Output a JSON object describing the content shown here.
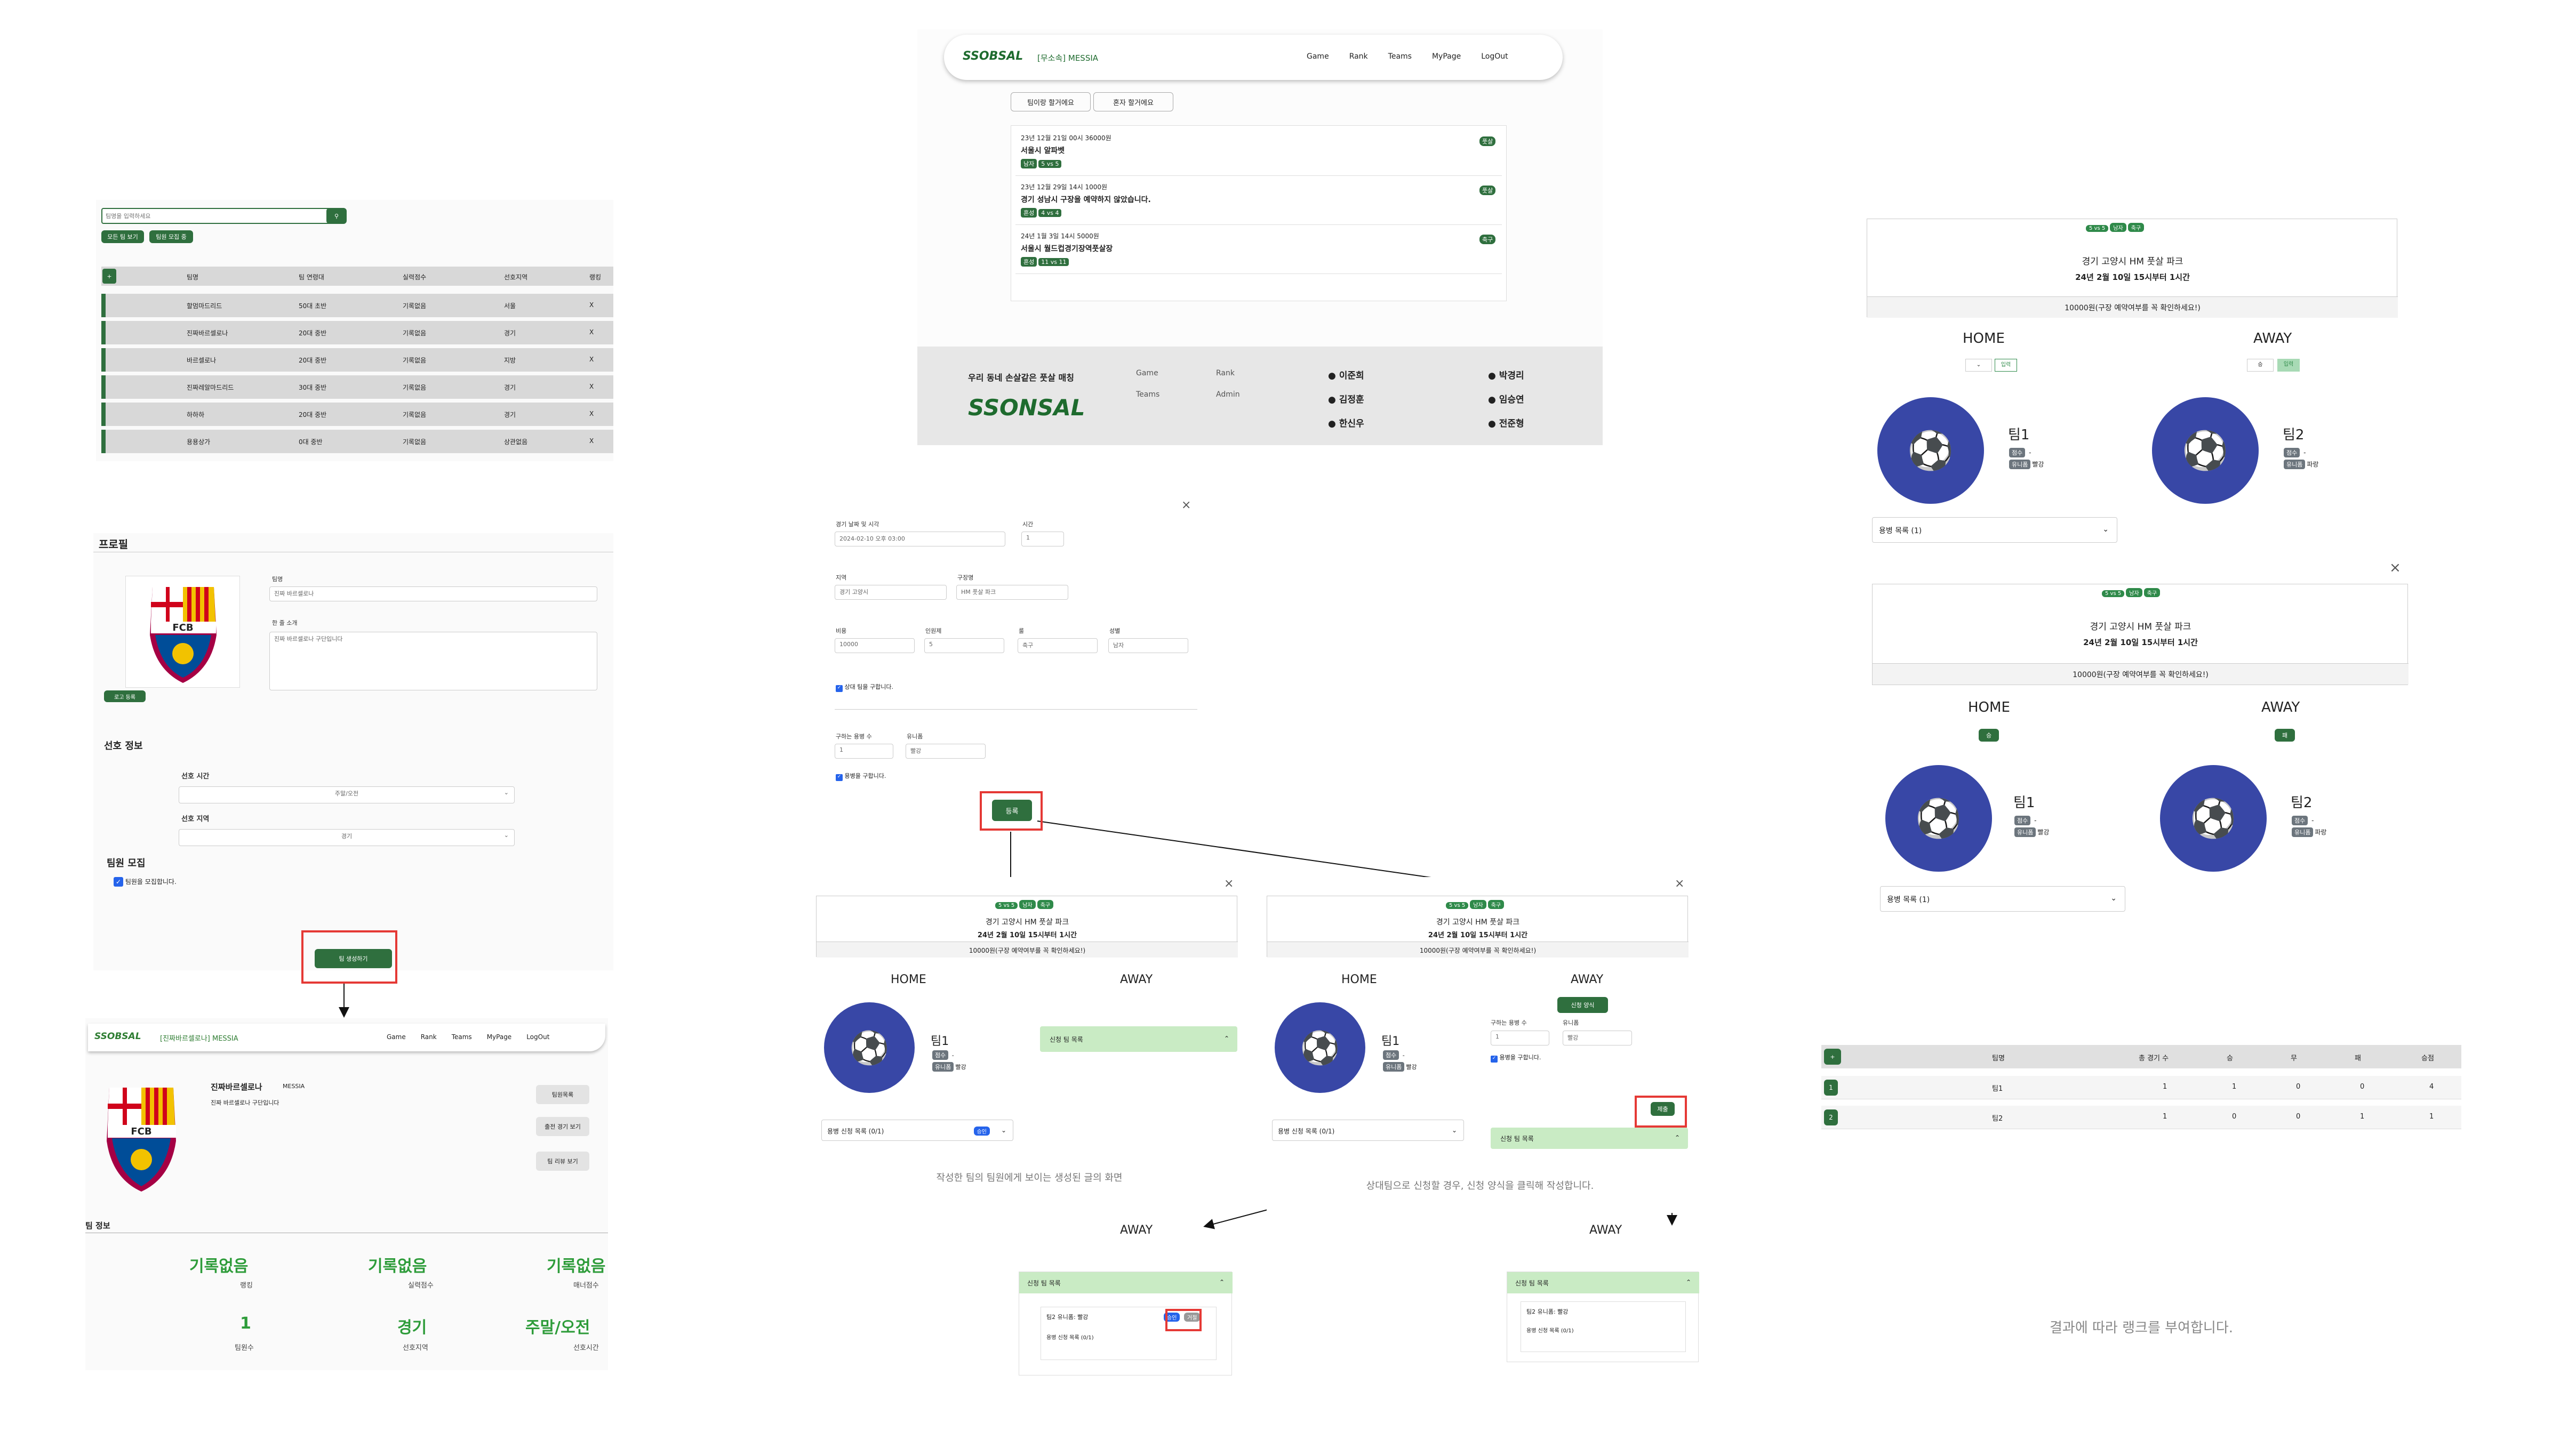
{
  "team_list": {
    "search_placeholder": "팀명을 입력하세요",
    "btn_all": "모든 팀 보기",
    "btn_recruit": "팀원 모집 중",
    "headers": [
      "팀명",
      "팀 연령대",
      "실력점수",
      "선호지역",
      "랭킹"
    ],
    "rows": [
      [
        "할멈마드리드",
        "50대 초반",
        "기록없음",
        "서울",
        "X"
      ],
      [
        "진짜바르셀로나",
        "20대 중반",
        "기록없음",
        "경기",
        "X"
      ],
      [
        "바르셀로나",
        "20대 중반",
        "기록없음",
        "지방",
        "X"
      ],
      [
        "진짜레알마드리드",
        "30대 중반",
        "기록없음",
        "경기",
        "X"
      ],
      [
        "하하하",
        "20대 중반",
        "기록없음",
        "경기",
        "X"
      ],
      [
        "용용상가",
        "0대 중반",
        "기록없음",
        "상관없음",
        "X"
      ]
    ]
  },
  "profile_form": {
    "title": "프로필",
    "logo_btn": "로고 등록",
    "team_name_label": "팀명",
    "team_name_value": "진짜 바르셀로나",
    "intro_label": "한 줄 소개",
    "intro_value": "진짜 바르셀로나 구단입니다",
    "pref_title": "선호 정보",
    "pref_time_label": "선호 시간",
    "pref_time_value": "주말/오전",
    "pref_area_label": "선호 지역",
    "pref_area_value": "경기",
    "recruit_title": "팀원 모집",
    "recruit_check": "팀원을 모집합니다.",
    "create_btn": "팀 생성하기"
  },
  "team_page": {
    "logo": "SSOBSAL",
    "user": "[진짜바르셀로나] MESSIA",
    "nav": [
      "Game",
      "Rank",
      "Teams",
      "MyPage",
      "LogOut"
    ],
    "team_name": "진짜바르셀로나",
    "leader": "MESSIA",
    "intro": "진짜 바르셀로나 구단입니다",
    "btn_members": "팀원목록",
    "btn_games": "출전 경기 보기",
    "btn_reviews": "팀 리뷰 보기",
    "section": "팀 정보",
    "stats": [
      {
        "value": "기록없음",
        "label": "랭킹"
      },
      {
        "value": "기록없음",
        "label": "실력점수"
      },
      {
        "value": "기록없음",
        "label": "매너점수"
      },
      {
        "value": "1",
        "label": "팀원수"
      },
      {
        "value": "경기",
        "label": "선호지역"
      },
      {
        "value": "주말/오전",
        "label": "선호시간"
      }
    ]
  },
  "home": {
    "logo": "SSOBSAL",
    "user": "[무소속] MESSIA",
    "nav": [
      "Game",
      "Rank",
      "Teams",
      "MyPage",
      "LogOut"
    ],
    "tab_team": "팀이랑 할거에요",
    "tab_solo": "혼자 할거에요",
    "games": [
      {
        "meta": "23년 12월 21일 00시 36000원",
        "title": "서울시 알파벳",
        "tags": [
          "남자",
          "5 vs 5"
        ],
        "kind": "풋살"
      },
      {
        "meta": "23년 12월 29일 14시 1000원",
        "title": "경기 성남시 구장을 예약하지 않았습니다.",
        "tags": [
          "혼성",
          "4 vs 4"
        ],
        "kind": "풋살"
      },
      {
        "meta": "24년 1월 3일 14시 5000원",
        "title": "서울시 월드컵경기장역풋살장",
        "tags": [
          "혼성",
          "11 vs 11"
        ],
        "kind": "축구"
      }
    ],
    "footer_slogan": "우리 동네 손살같은 풋살 매칭",
    "footer_logo": "SSONSAL",
    "footer_links": [
      "Game",
      "Rank",
      "Teams",
      "Admin"
    ],
    "members": [
      "이준희",
      "박경리",
      "김정훈",
      "임승연",
      "한신우",
      "전준형"
    ]
  },
  "game_form": {
    "date_label": "경기 날짜 및 시각",
    "date_value": "2024-02-10 오후 03:00",
    "time_label": "시간",
    "time_value": "1",
    "region_label": "지역",
    "region_value": "경기 고양시",
    "stadium_label": "구장명",
    "stadium_value": "HM 풋살 파크",
    "cost_label": "비용",
    "cost_value": "10000",
    "people_label": "인원제",
    "people_value": "5",
    "type_label": "룰",
    "type_value": "축구",
    "gender_label": "성별",
    "gender_value": "남자",
    "opp_check": "상대 팀을 구합니다.",
    "merc_label": "구하는 용병 수",
    "merc_value": "1",
    "uniform_label": "유니폼",
    "uniform_value": "빨강",
    "merc_check": "용병을 구합니다.",
    "submit": "등록"
  },
  "game_card": {
    "tags": [
      "5 vs 5",
      "남자",
      "축구"
    ],
    "place": "경기 고양시 HM 풋살 파크",
    "when": "24년 2월 10일 15시부터 1시간",
    "cost": "10000원(구장 예약여부를 꼭 확인하세요!)",
    "home": "HOME",
    "away": "AWAY",
    "team1": "팀1",
    "team2": "팀2",
    "tag_score": "점수",
    "tag_uniform": "유니폼",
    "uniform1": "빨강",
    "uniform2": "파랑",
    "merc_list": "용병 신청 목록 (0/1)",
    "apply_list": "신청 팀 목록",
    "apply_form": "신청 양식",
    "apply_btn": "제출",
    "caption_member": "작성한 팀의 팀원에게 보이는 생성된 글의 화면",
    "caption_apply": "상대팀으로 신청할 경우, 신청 양식을 클릭해 작성합니다.",
    "accept": "승인",
    "reject": "거절",
    "team2_entry": "팀2 유니폼: 빨강",
    "merc_count": "용병 목록 (1)",
    "input_btn": "입력",
    "win": "승",
    "lose": "패"
  },
  "rank": {
    "headers": [
      "팀명",
      "총 경기 수",
      "승",
      "무",
      "패",
      "승점"
    ],
    "rows": [
      [
        "1",
        "팀1",
        "1",
        "1",
        "0",
        "0",
        "4"
      ],
      [
        "2",
        "팀2",
        "1",
        "0",
        "0",
        "1",
        "1"
      ]
    ],
    "caption": "결과에 따라 랭크를 부여합니다."
  }
}
